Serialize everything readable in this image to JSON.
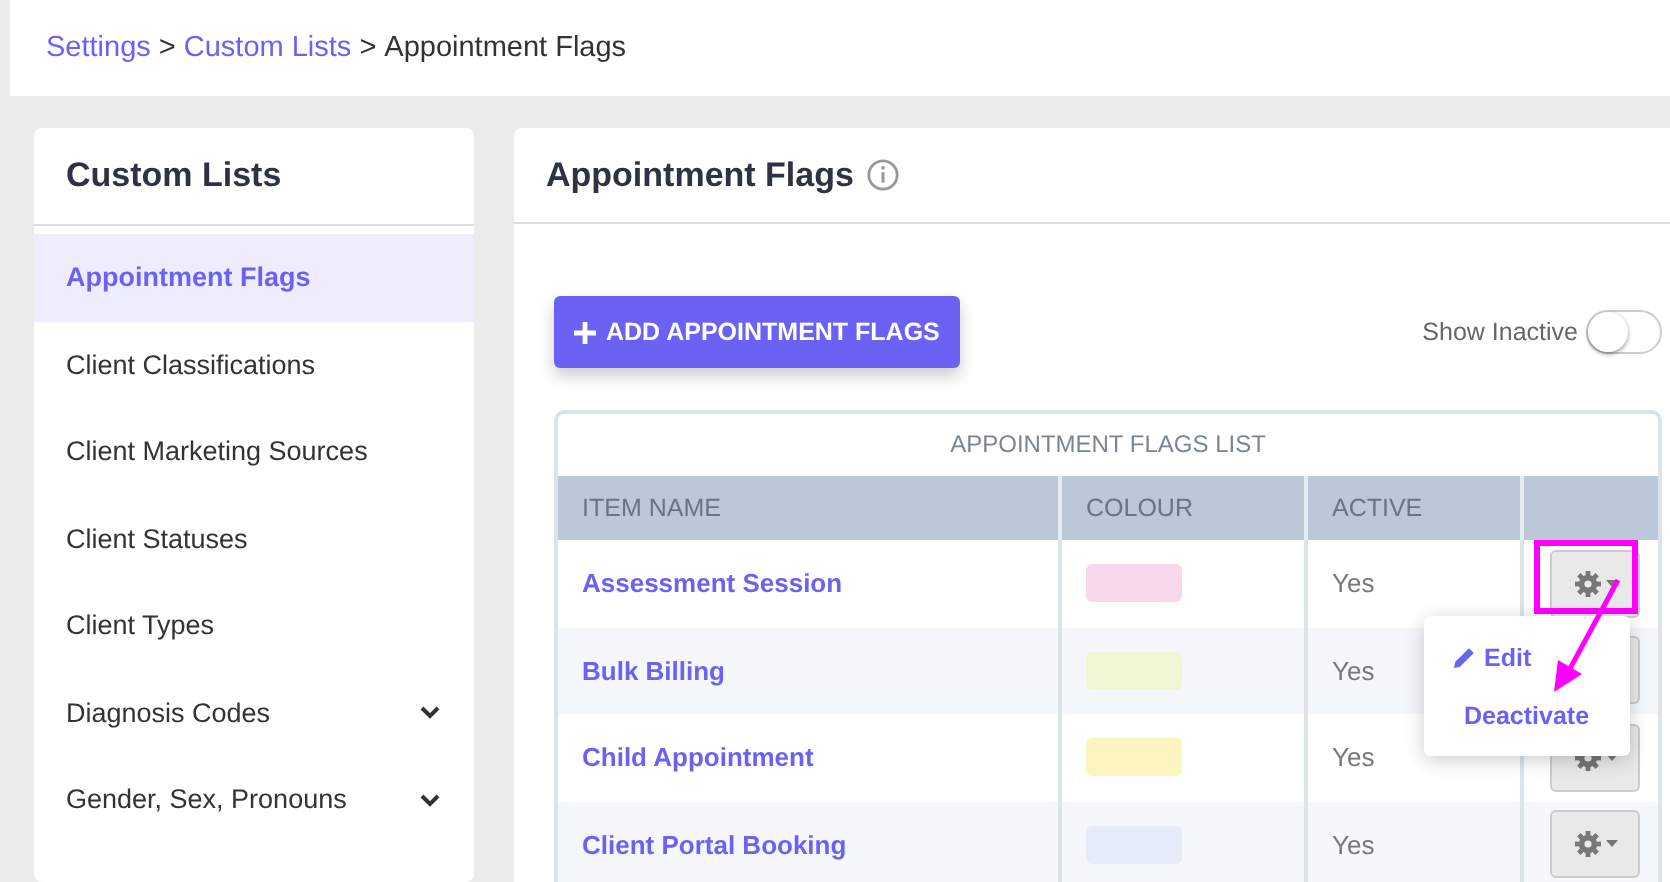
{
  "breadcrumb": [
    {
      "label": "Settings",
      "link": true
    },
    {
      "label": ">",
      "link": false
    },
    {
      "label": "Custom Lists",
      "link": true
    },
    {
      "label": ">",
      "link": false
    },
    {
      "label": "Appointment Flags",
      "link": false
    }
  ],
  "sidebar": {
    "title": "Custom Lists",
    "items": [
      {
        "label": "Appointment Flags",
        "selected": true,
        "expandable": false
      },
      {
        "label": "Client Classifications",
        "selected": false,
        "expandable": false
      },
      {
        "label": "Client Marketing Sources",
        "selected": false,
        "expandable": false
      },
      {
        "label": "Client Statuses",
        "selected": false,
        "expandable": false
      },
      {
        "label": "Client Types",
        "selected": false,
        "expandable": false
      },
      {
        "label": "Diagnosis Codes",
        "selected": false,
        "expandable": true
      },
      {
        "label": "Gender, Sex, Pronouns",
        "selected": false,
        "expandable": true
      }
    ]
  },
  "main": {
    "title": "Appointment Flags",
    "add_button": "ADD APPOINTMENT FLAGS",
    "show_inactive": {
      "label": "Show Inactive",
      "on": false
    },
    "table": {
      "caption": "APPOINTMENT FLAGS LIST",
      "columns": [
        "ITEM NAME",
        "COLOUR",
        "ACTIVE"
      ],
      "rows": [
        {
          "name": "Assessment Session",
          "color": "#f8d8ec",
          "active": "Yes",
          "highlighted": true,
          "menu_open": true
        },
        {
          "name": "Bulk Billing",
          "color": "#eef8d4",
          "active": "Yes",
          "highlighted": false,
          "menu_open": false
        },
        {
          "name": "Child Appointment",
          "color": "#fdf5c0",
          "active": "Yes",
          "highlighted": false,
          "menu_open": false
        },
        {
          "name": "Client Portal Booking",
          "color": "#e5ebf8",
          "active": "Yes",
          "highlighted": false,
          "menu_open": false
        }
      ]
    },
    "menu": [
      {
        "label": "Edit",
        "kind": "edit"
      },
      {
        "label": "Deactivate",
        "kind": "plain"
      }
    ]
  }
}
